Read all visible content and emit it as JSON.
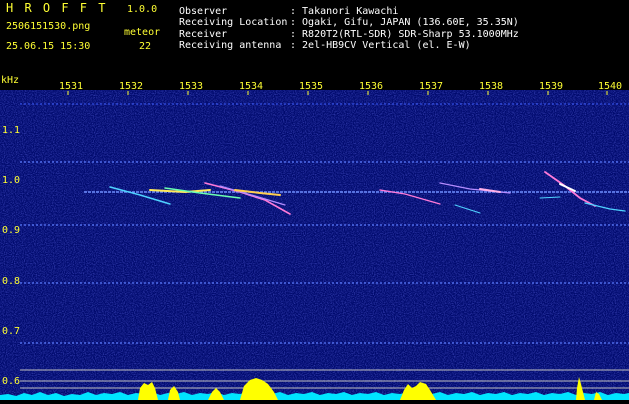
{
  "app": {
    "name": "H R O F F T",
    "version": "1.0.0",
    "filename": "2506151530.png",
    "datetime": "25.06.15 15:30",
    "meteor_label": "meteor",
    "meteor_count": "22"
  },
  "info": {
    "observer_label": "Observer",
    "observer_value": ": Takanori Kawachi",
    "location_label": "Receiving Location",
    "location_value": ": Ogaki, Gifu, JAPAN (136.60E, 35.35N)",
    "receiver_label": "Receiver",
    "receiver_value": ": R820T2(RTL-SDR) SDR-Sharp 53.1000MHz",
    "antenna_label": "Receiving antenna",
    "antenna_value": ": 2el-HB9CV Vertical (el. E-W)"
  },
  "axis": {
    "y_unit": "kHz",
    "x_ticks": [
      "1531",
      "1532",
      "1533",
      "1534",
      "1535",
      "1536",
      "1537",
      "1538",
      "1539",
      "1540"
    ],
    "y_ticks": [
      "1.1",
      "1.0",
      "0.9",
      "0.8",
      "0.7",
      "0.6"
    ]
  },
  "colors": {
    "background": "#000000",
    "spectrum_bg": "#000a6e",
    "axis_text": "#ffff33",
    "header_text": "#ffffff",
    "noise_floor": "#00e5ff",
    "peaks": "#ffff00"
  }
}
